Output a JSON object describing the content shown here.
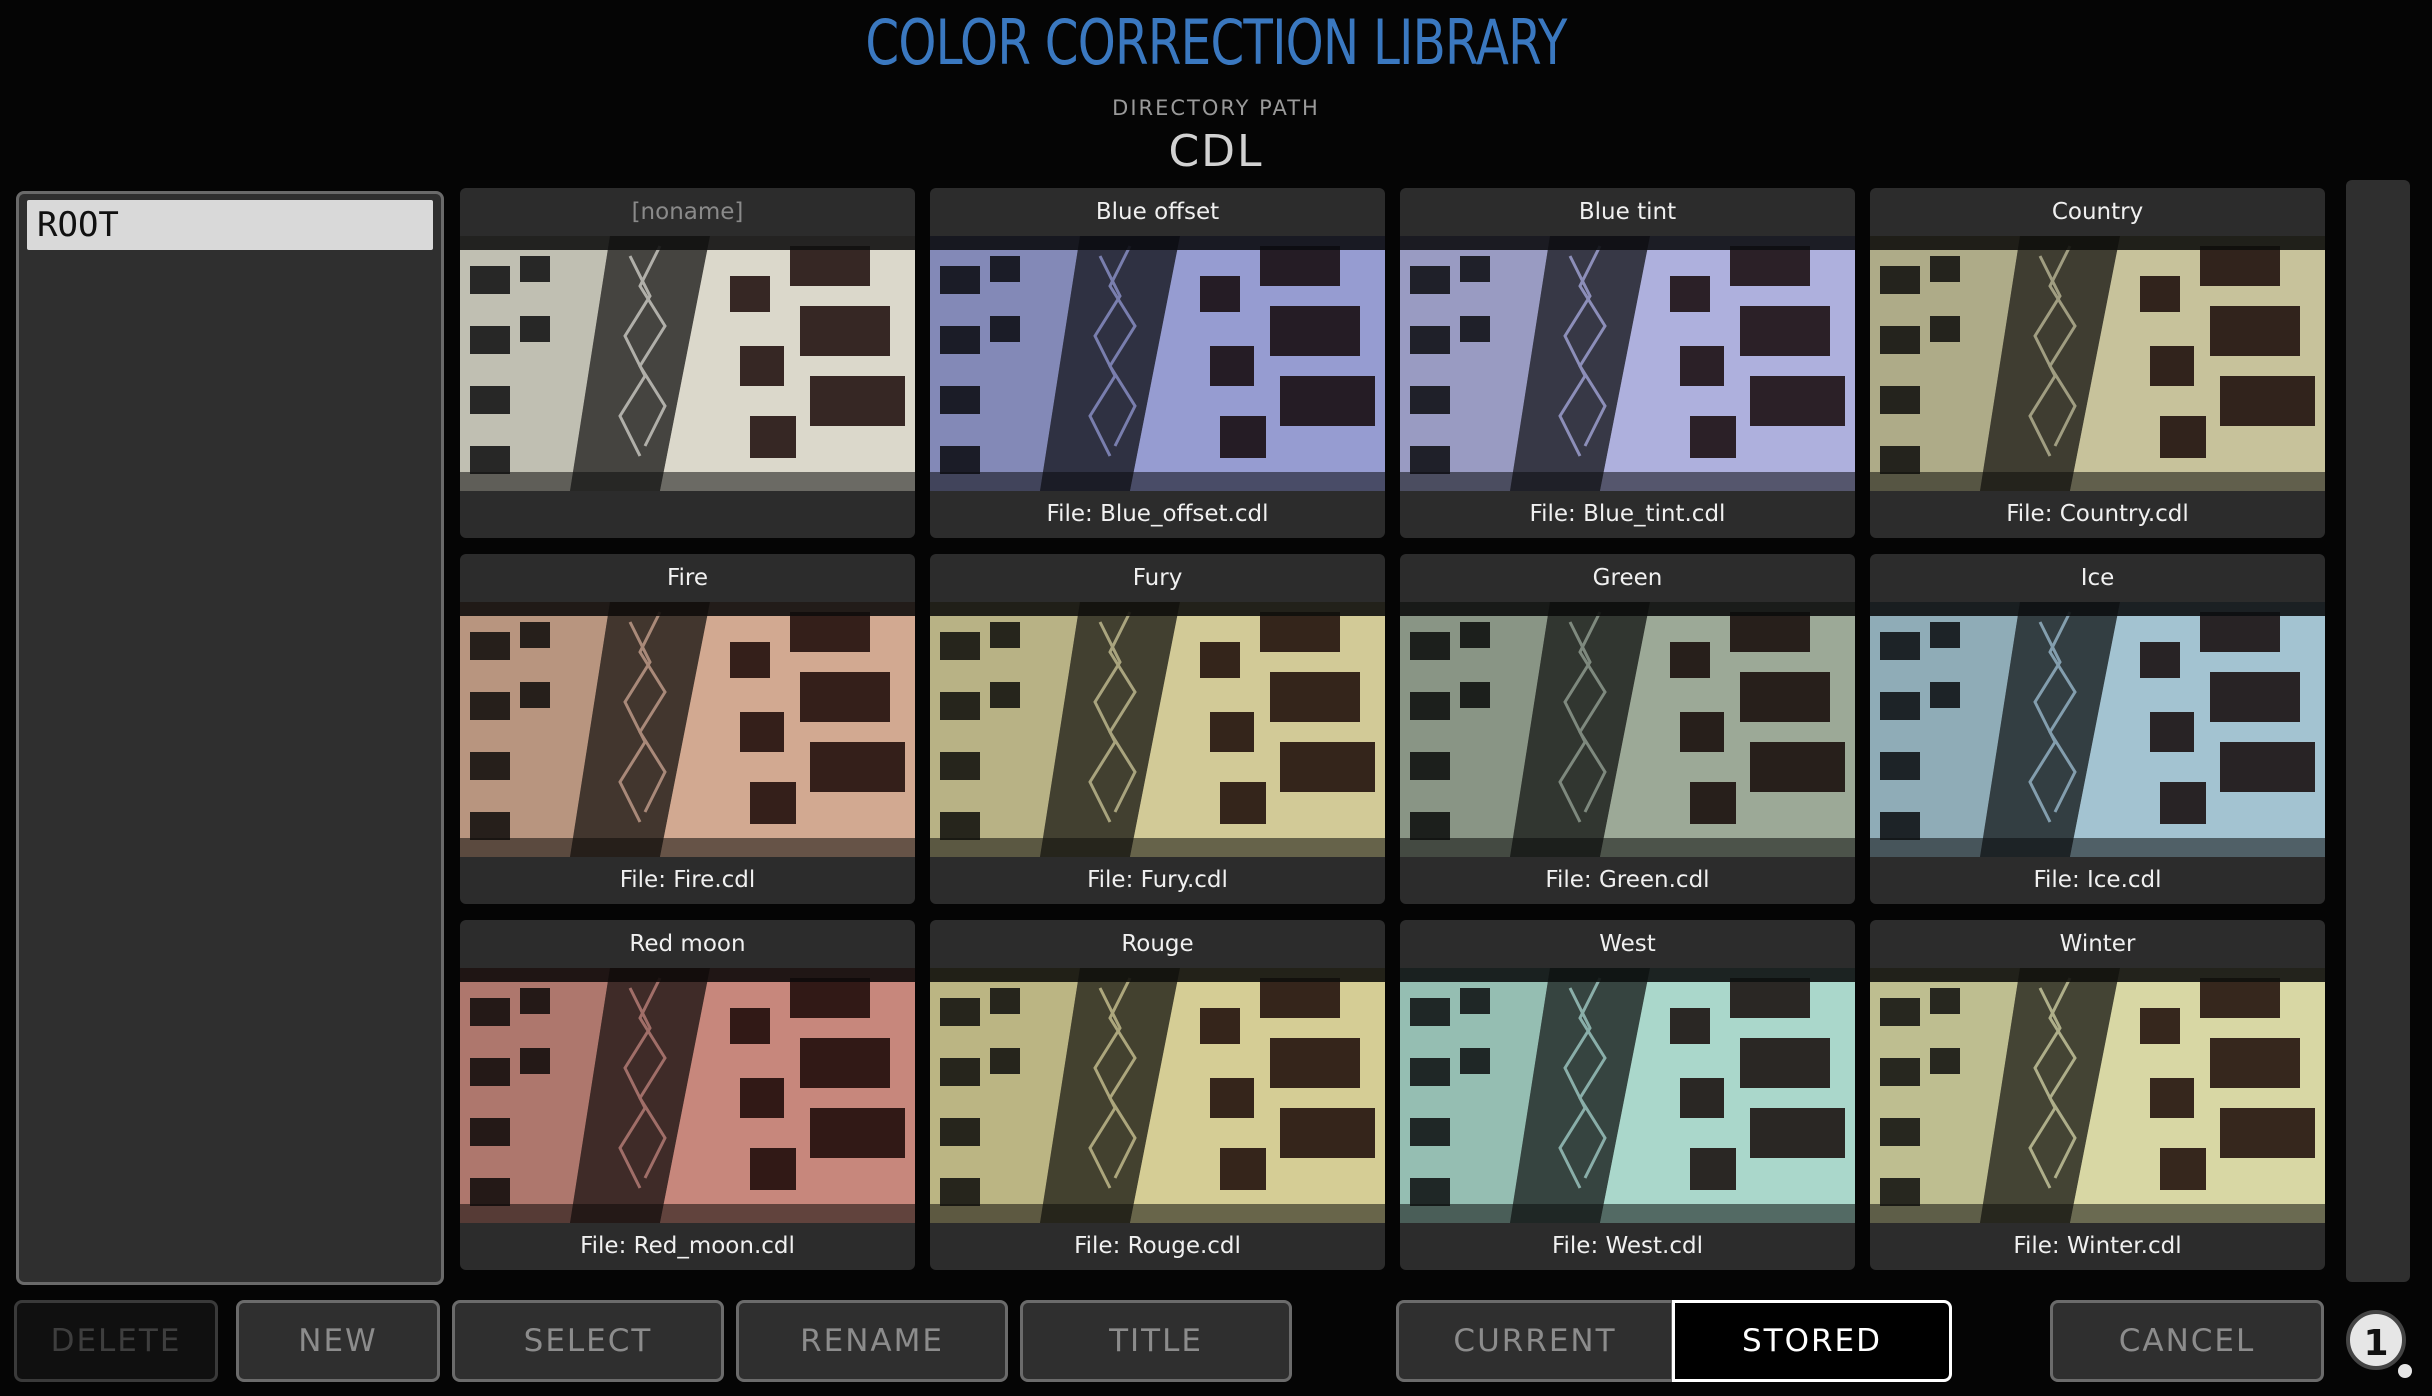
{
  "title": "COLOR CORRECTION LIBRARY",
  "directory": {
    "label": "DIRECTORY PATH",
    "value": "CDL"
  },
  "tree": {
    "items": [
      {
        "label": "ROOT"
      }
    ]
  },
  "tiles": [
    {
      "name": "[noname]",
      "file": "",
      "tint": "#b8b090",
      "opacity": 0.25
    },
    {
      "name": "Blue offset",
      "file": "File: Blue_offset.cdl",
      "tint": "#3040d0",
      "opacity": 0.45
    },
    {
      "name": "Blue tint",
      "file": "File: Blue_tint.cdl",
      "tint": "#6a70f0",
      "opacity": 0.45
    },
    {
      "name": "Country",
      "file": "File: Country.cdl",
      "tint": "#9a9030",
      "opacity": 0.4
    },
    {
      "name": "Fire",
      "file": "File: Fire.cdl",
      "tint": "#c06030",
      "opacity": 0.45
    },
    {
      "name": "Fury",
      "file": "File: Fury.cdl",
      "tint": "#c0b040",
      "opacity": 0.45
    },
    {
      "name": "Green",
      "file": "File: Green.cdl",
      "tint": "#406040",
      "opacity": 0.45
    },
    {
      "name": "Ice",
      "file": "File: Ice.cdl",
      "tint": "#50a0d0",
      "opacity": 0.45
    },
    {
      "name": "Red moon",
      "file": "File: Red_moon.cdl",
      "tint": "#b02818",
      "opacity": 0.5
    },
    {
      "name": "Rouge",
      "file": "File: Rouge.cdl",
      "tint": "#d0c050",
      "opacity": 0.5
    },
    {
      "name": "West",
      "file": "File: West.cdl",
      "tint": "#60d0c0",
      "opacity": 0.45
    },
    {
      "name": "Winter",
      "file": "File: Winter.cdl",
      "tint": "#d0d060",
      "opacity": 0.45
    }
  ],
  "buttons": {
    "delete": "DELETE",
    "new": "NEW",
    "select": "SELECT",
    "rename": "RENAME",
    "title": "TITLE",
    "current": "CURRENT",
    "stored": "STORED",
    "cancel": "CANCEL"
  },
  "badge": "1"
}
